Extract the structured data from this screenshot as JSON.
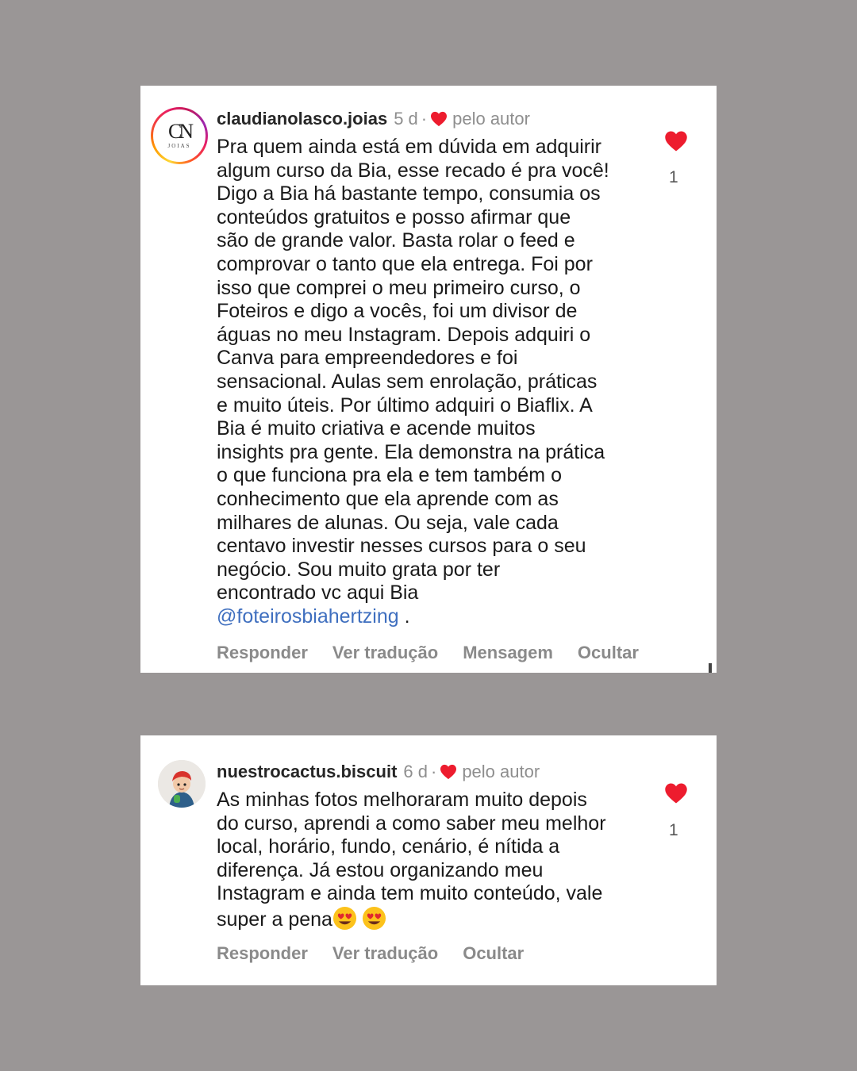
{
  "comments": [
    {
      "username": "claudianolasco.joias",
      "time": "5 d",
      "separator": "·",
      "liked_by_author": "pelo autor",
      "avatar_logo": {
        "letters": "CN",
        "subtitle": "JOIAS"
      },
      "text": "Pra quem ainda está em dúvida em adquirir\nalgum curso da Bia, esse recado é pra você!\nDigo a Bia há bastante tempo, consumia os\nconteúdos gratuitos e posso afirmar que\nsão de grande valor. Basta rolar o feed e\ncomprovar o tanto que ela entrega. Foi por\nisso que comprei o meu primeiro curso, o\nFoteiros e digo a vocês, foi um divisor de\náguas no meu Instagram. Depois adquiri o\nCanva para empreendedores e foi\nsensacional. Aulas sem enrolação, práticas\ne muito úteis. Por último adquiri o Biaflix. A\nBia é muito criativa e acende muitos\ninsights pra gente. Ela demonstra na prática\no que funciona pra ela e tem também o\nconhecimento que ela aprende com as\nmilhares de alunas. Ou seja, vale cada\ncentavo investir nesses cursos para o seu\nnegócio. Sou muito grata por ter\nencontrado vc aqui Bia\n",
      "mention": "@foteirosbiahertzing",
      "text_end": " .",
      "likes": "1",
      "actions": [
        "Responder",
        "Ver tradução",
        "Mensagem",
        "Ocultar"
      ]
    },
    {
      "username": "nuestrocactus.biscuit",
      "time": "6 d",
      "separator": "·",
      "liked_by_author": "pelo autor",
      "text": "As minhas fotos melhoraram muito depois\ndo curso, aprendi a como saber meu melhor\nlocal, horário, fundo, cenário, é nítida a\ndiferença. Já estou organizando meu\nInstagram e ainda tem muito conteúdo, vale\nsuper a pena",
      "emojis": [
        "heart-eyes-emoji",
        "heart-eyes-emoji"
      ],
      "likes": "1",
      "actions": [
        "Responder",
        "Ver tradução",
        "Ocultar"
      ]
    }
  ],
  "colors": {
    "background": "#9a9696",
    "card": "#ffffff",
    "heart": "#ed1c2e",
    "mention": "#3f6fbf",
    "muted": "#8e8e8e"
  }
}
